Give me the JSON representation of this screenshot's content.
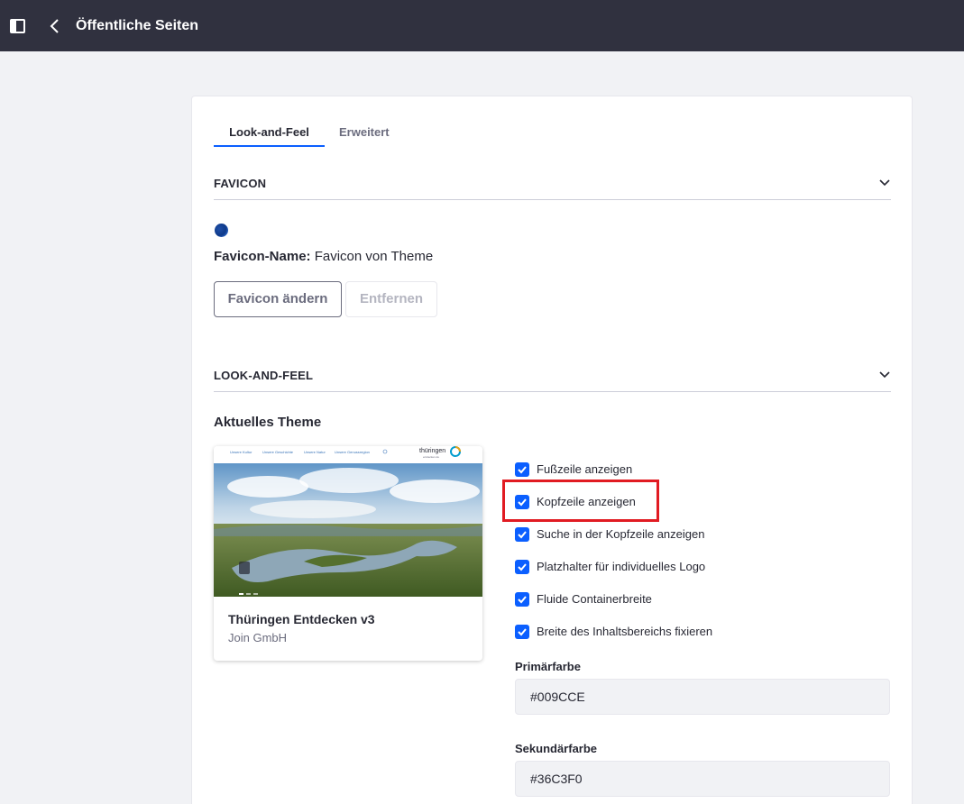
{
  "topbar": {
    "title": "Öffentliche Seiten",
    "panel_icon": "sidebar-panel-icon",
    "back_icon": "chevron-left-icon"
  },
  "tabs": [
    {
      "label": "Look-and-Feel",
      "active": true
    },
    {
      "label": "Erweitert",
      "active": false
    }
  ],
  "favicon_section": {
    "header": "FAVICON",
    "name_label": "Favicon-Name:",
    "name_value": "Favicon von Theme",
    "change_button": "Favicon ändern",
    "remove_button": "Entfernen"
  },
  "look_and_feel_section": {
    "header": "LOOK-AND-FEEL",
    "current_theme_heading": "Aktuelles Theme",
    "theme": {
      "name": "Thüringen Entdecken v3",
      "author": "Join GmbH",
      "preview_nav": [
        "Unsere Kultur",
        "Unsere Geschichte",
        "Unsere Natur",
        "Unsere Genussregion"
      ],
      "preview_brand": "thüringen",
      "preview_brand_sub": "entdecken.de"
    },
    "options": [
      {
        "label": "Fußzeile anzeigen",
        "checked": true
      },
      {
        "label": "Kopfzeile anzeigen",
        "checked": true,
        "highlighted": true
      },
      {
        "label": "Suche in der Kopfzeile anzeigen",
        "checked": true
      },
      {
        "label": "Platzhalter für individuelles Logo",
        "checked": true
      },
      {
        "label": "Fluide Containerbreite",
        "checked": true
      },
      {
        "label": "Breite des Inhaltsbereichs fixieren",
        "checked": true
      }
    ],
    "primary_color_label": "Primärfarbe",
    "primary_color_value": "#009CCE",
    "secondary_color_label": "Sekundärfarbe",
    "secondary_color_value": "#36C3F0"
  },
  "colors": {
    "topbar": "#30313f",
    "accent": "#0b5fff",
    "highlight": "#e11b22"
  }
}
